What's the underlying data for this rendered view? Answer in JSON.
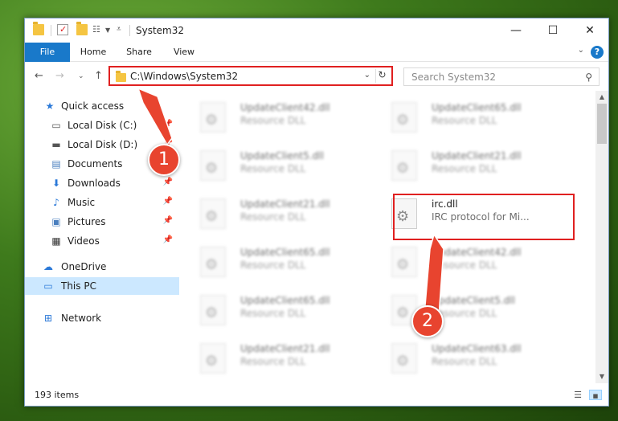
{
  "window": {
    "title": "System32",
    "controls": {
      "minimize": "—",
      "maximize": "☐",
      "close": "✕"
    }
  },
  "ribbon": {
    "tabs": [
      {
        "label": "File"
      },
      {
        "label": "Home"
      },
      {
        "label": "Share"
      },
      {
        "label": "View"
      }
    ],
    "help_label": "?"
  },
  "nav": {
    "address_path": "C:\\Windows\\System32",
    "search_placeholder": "Search System32"
  },
  "sidebar": {
    "items": [
      {
        "label": "Quick access",
        "icon": "star-icon",
        "pinned": false
      },
      {
        "label": "Local Disk (C:)",
        "icon": "drive-icon",
        "pinned": true
      },
      {
        "label": "Local Disk (D:)",
        "icon": "drive-icon",
        "pinned": true
      },
      {
        "label": "Documents",
        "icon": "documents-icon",
        "pinned": true
      },
      {
        "label": "Downloads",
        "icon": "downloads-icon",
        "pinned": true
      },
      {
        "label": "Music",
        "icon": "music-icon",
        "pinned": true
      },
      {
        "label": "Pictures",
        "icon": "pictures-icon",
        "pinned": true
      },
      {
        "label": "Videos",
        "icon": "videos-icon",
        "pinned": true
      },
      {
        "label": "OneDrive",
        "icon": "cloud-icon",
        "pinned": false
      },
      {
        "label": "This PC",
        "icon": "computer-icon",
        "pinned": false,
        "selected": true
      },
      {
        "label": "Network",
        "icon": "network-icon",
        "pinned": false
      }
    ]
  },
  "files": {
    "left_column": [
      {
        "name": "UpdateClient42.dll",
        "type": "Resource DLL"
      },
      {
        "name": "UpdateClient5.dll",
        "type": "Resource DLL"
      },
      {
        "name": "UpdateClient21.dll",
        "type": "Resource DLL"
      },
      {
        "name": "UpdateClient65.dll",
        "type": "Resource DLL"
      },
      {
        "name": "UpdateClient65.dll",
        "type": "Resource DLL"
      },
      {
        "name": "UpdateClient21.dll",
        "type": "Resource DLL"
      }
    ],
    "right_column": [
      {
        "name": "UpdateClient65.dll",
        "type": "Resource DLL"
      },
      {
        "name": "UpdateClient21.dll",
        "type": "Resource DLL"
      },
      {
        "name": "irc.dll",
        "type": "IRC protocol for Mi...",
        "highlighted": true
      },
      {
        "name": "UpdateClient42.dll",
        "type": "Resource DLL"
      },
      {
        "name": "UpdateClient5.dll",
        "type": "Resource DLL"
      },
      {
        "name": "UpdateClient63.dll",
        "type": "Resource DLL"
      }
    ]
  },
  "status": {
    "item_count": "193 items"
  },
  "annotations": {
    "step1": "1",
    "step2": "2",
    "color": "#e8442f"
  }
}
